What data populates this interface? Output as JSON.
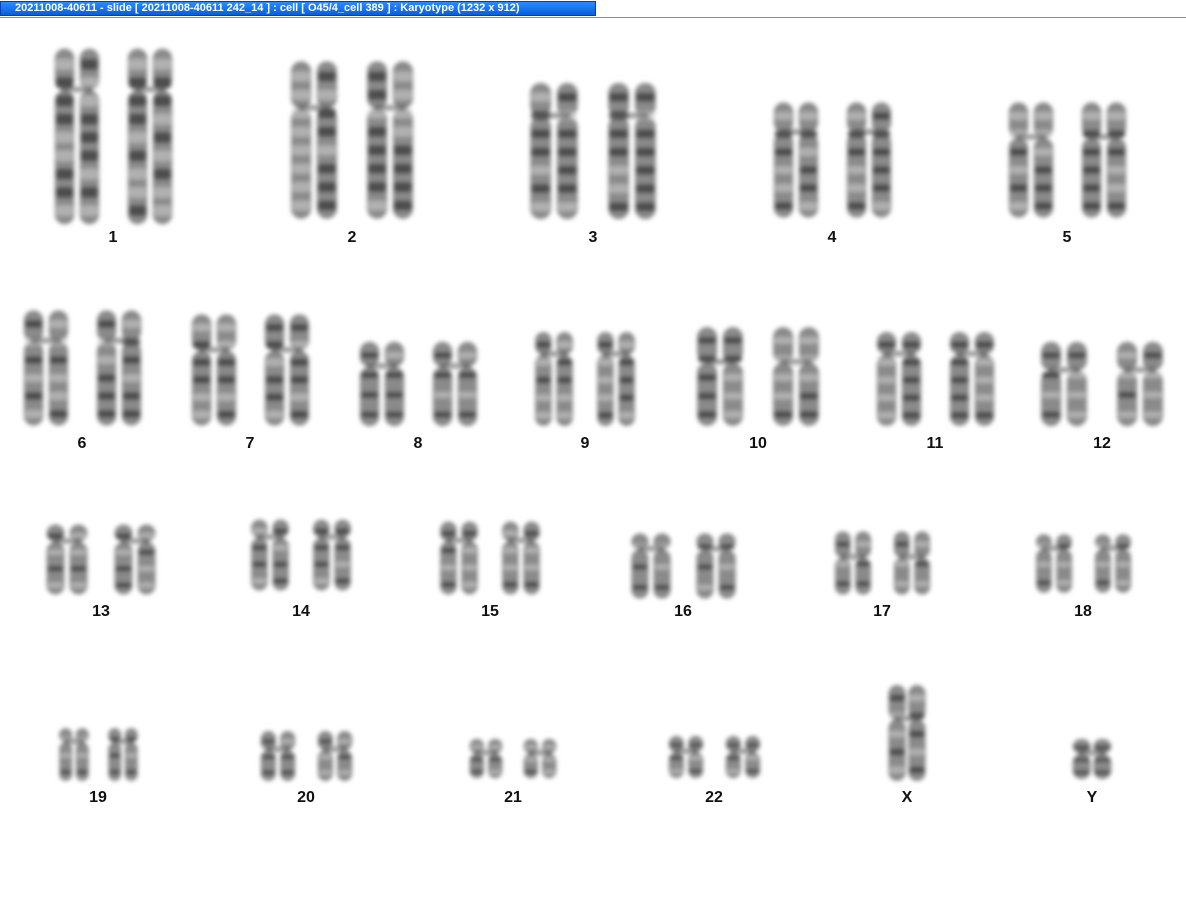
{
  "window": {
    "title": "20211008-40611 - slide [ 20211008-40611 242_14 ] : cell [ O45/4_cell 389 ] : Karyotype  (1232 x 912)"
  },
  "karyotype": {
    "pairs": [
      {
        "label": "1",
        "count": 2
      },
      {
        "label": "2",
        "count": 2
      },
      {
        "label": "3",
        "count": 2
      },
      {
        "label": "4",
        "count": 2
      },
      {
        "label": "5",
        "count": 2
      },
      {
        "label": "6",
        "count": 2
      },
      {
        "label": "7",
        "count": 2
      },
      {
        "label": "8",
        "count": 2
      },
      {
        "label": "9",
        "count": 2
      },
      {
        "label": "10",
        "count": 2
      },
      {
        "label": "11",
        "count": 2
      },
      {
        "label": "12",
        "count": 2
      },
      {
        "label": "13",
        "count": 2
      },
      {
        "label": "14",
        "count": 2
      },
      {
        "label": "15",
        "count": 2
      },
      {
        "label": "16",
        "count": 2
      },
      {
        "label": "17",
        "count": 2
      },
      {
        "label": "18",
        "count": 2
      },
      {
        "label": "19",
        "count": 2
      },
      {
        "label": "20",
        "count": 2
      },
      {
        "label": "21",
        "count": 2
      },
      {
        "label": "22",
        "count": 2
      },
      {
        "label": "X",
        "count": 1
      },
      {
        "label": "Y",
        "count": 1
      }
    ]
  }
}
